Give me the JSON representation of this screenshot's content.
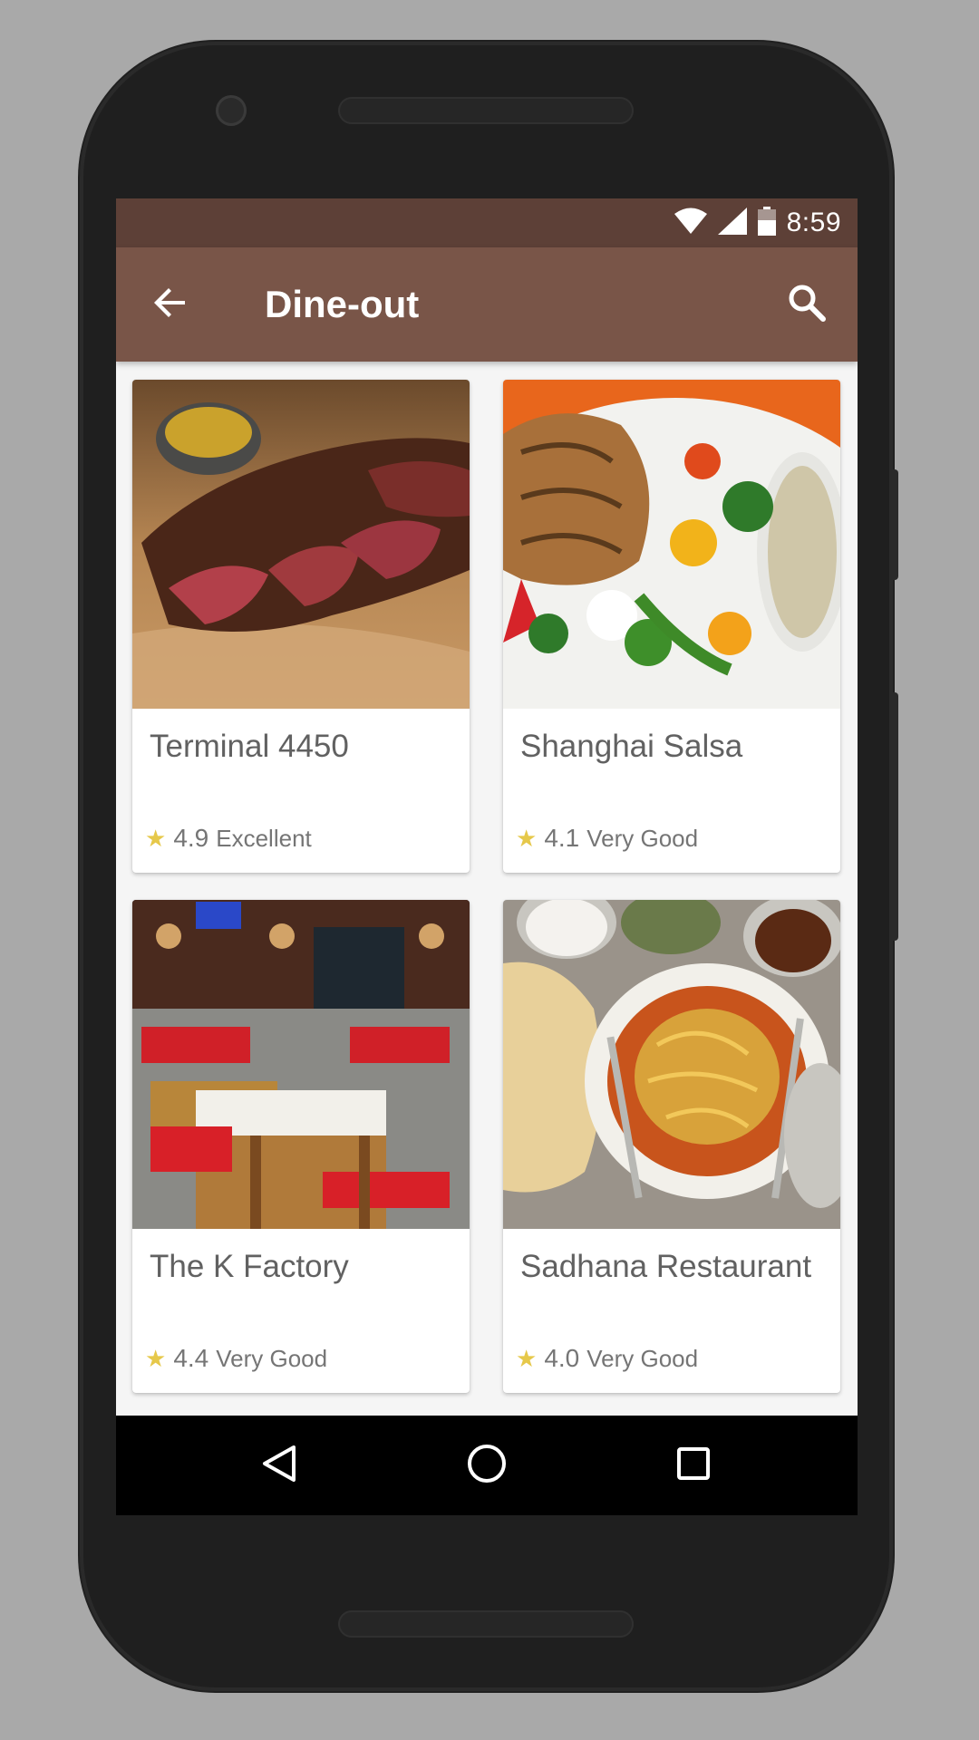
{
  "status_bar": {
    "time": "8:59",
    "icons": [
      "wifi-icon",
      "cell-signal-icon",
      "battery-icon"
    ]
  },
  "app_bar": {
    "title": "Dine-out",
    "back_icon": "arrow-back-icon",
    "search_icon": "search-icon"
  },
  "restaurants": [
    {
      "name": "Terminal 4450",
      "rating": "4.9",
      "rating_label": "Excellent",
      "image": "sliced-steak-photo"
    },
    {
      "name": "Shanghai Salsa",
      "rating": "4.1",
      "rating_label": "Very Good",
      "image": "grilled-chicken-vegetables-photo"
    },
    {
      "name": "The K Factory",
      "rating": "4.4",
      "rating_label": "Very Good",
      "image": "restaurant-interior-photo"
    },
    {
      "name": "Sadhana Restaurant",
      "rating": "4.0",
      "rating_label": "Very Good",
      "image": "misal-pav-photo"
    }
  ],
  "nav_bar": {
    "buttons": [
      "back-triangle-icon",
      "home-circle-icon",
      "recents-square-icon"
    ]
  },
  "colors": {
    "status_bar": "#5d4037",
    "app_bar": "#795548",
    "star": "#e6c84a",
    "background": "#f5f5f5"
  }
}
